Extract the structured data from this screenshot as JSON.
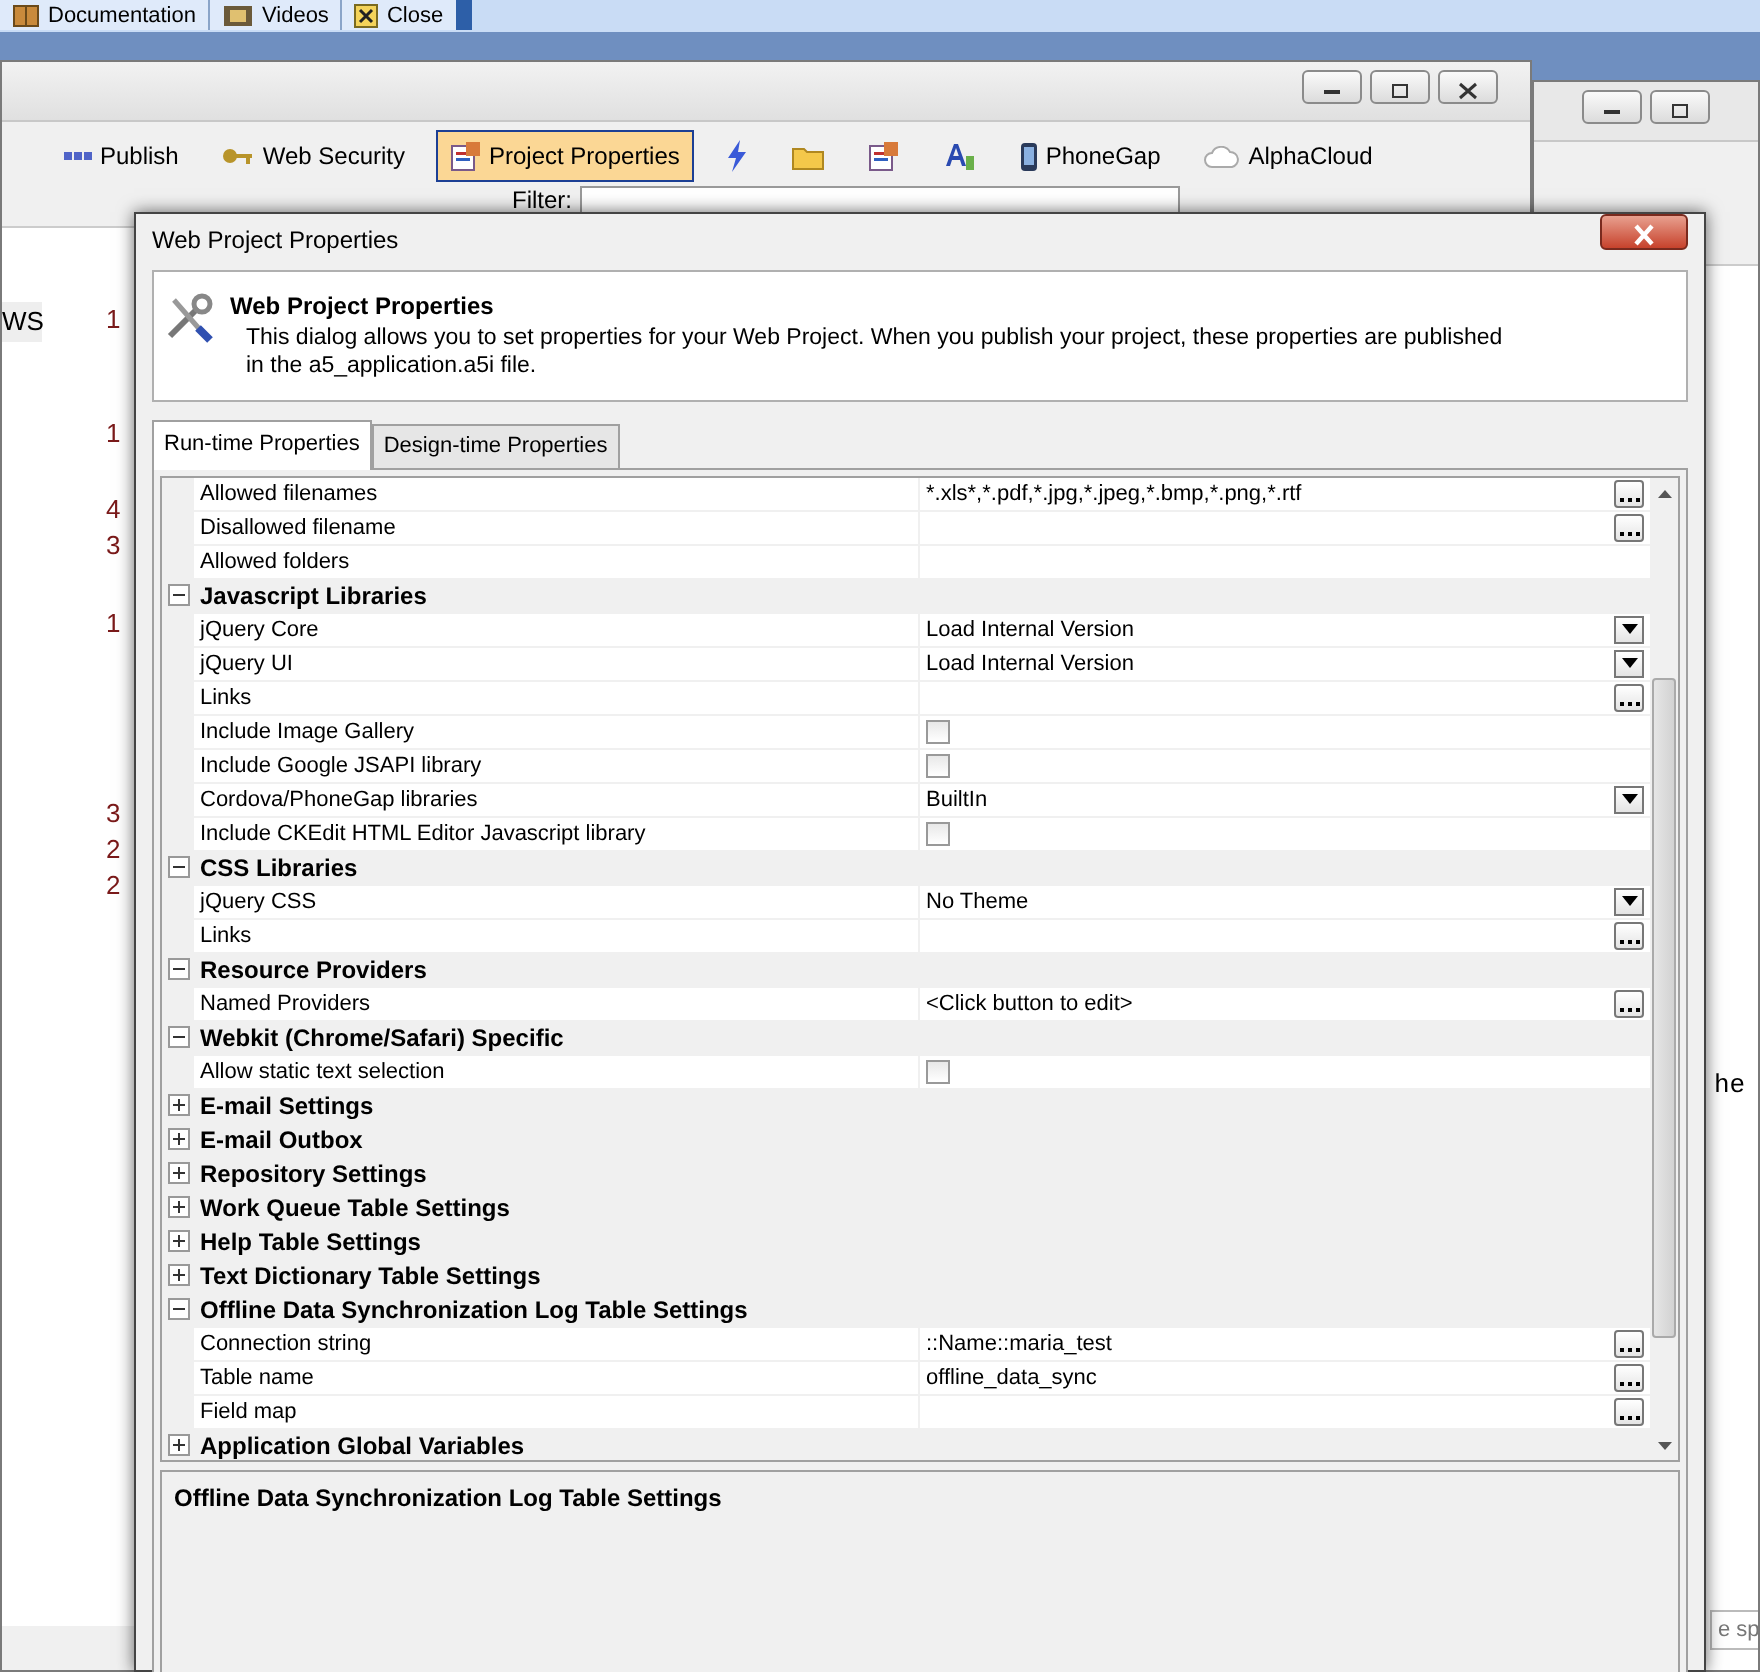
{
  "taskbar": {
    "buttons": [
      {
        "label": "Documentation"
      },
      {
        "label": "Videos"
      },
      {
        "label": "Close"
      }
    ]
  },
  "main_window": {
    "toolbar": [
      {
        "kind": "labeled",
        "label": "Publish",
        "selected": false
      },
      {
        "kind": "labeled",
        "label": "Web Security",
        "selected": false
      },
      {
        "kind": "labeled",
        "label": "Project Properties",
        "selected": true
      },
      {
        "kind": "icon",
        "selected": false
      },
      {
        "kind": "icon",
        "selected": false
      },
      {
        "kind": "icon",
        "selected": false
      },
      {
        "kind": "icon",
        "selected": false
      },
      {
        "kind": "labeled",
        "label": "PhoneGap",
        "selected": false
      },
      {
        "kind": "labeled",
        "label": "AlphaCloud",
        "selected": false
      }
    ],
    "filter_label": "Filter:",
    "list_item": "WS",
    "column_fragments": [
      "1",
      "1",
      "4",
      "3",
      "1",
      "3",
      "2",
      "2"
    ]
  },
  "side_window": {
    "text_fragment": "he",
    "field_fragment": "e sp"
  },
  "dialog": {
    "title": "Web Project Properties",
    "header": {
      "title": "Web Project Properties",
      "description": "This dialog allows you to set properties for your Web Project. When you publish your project, these properties are published in the a5_application.a5i file."
    },
    "tabs": [
      {
        "label": "Run-time Properties",
        "selected": true
      },
      {
        "label": "Design-time Properties",
        "selected": false
      }
    ],
    "rows": [
      {
        "kind": "ellipsis",
        "name": "Allowed filenames",
        "value": "*.xls*,*.pdf,*.jpg,*.jpeg,*.bmp,*.png,*.rtf"
      },
      {
        "kind": "ellipsis",
        "name": "Disallowed filename"
      },
      {
        "kind": "plain",
        "name": "Allowed folders"
      },
      {
        "kind": "category",
        "name": "Javascript Libraries",
        "expanded": true
      },
      {
        "kind": "dropdown",
        "name": "jQuery Core",
        "value": "Load Internal Version"
      },
      {
        "kind": "dropdown",
        "name": "jQuery UI",
        "value": "Load Internal Version"
      },
      {
        "kind": "ellipsis",
        "name": "Links"
      },
      {
        "kind": "checkbox",
        "name": "Include Image Gallery",
        "checked": false
      },
      {
        "kind": "checkbox",
        "name": "Include Google JSAPI library",
        "checked": false
      },
      {
        "kind": "dropdown",
        "name": "Cordova/PhoneGap libraries",
        "value": "BuiltIn"
      },
      {
        "kind": "checkbox",
        "name": "Include CKEdit HTML Editor Javascript library",
        "checked": false
      },
      {
        "kind": "category",
        "name": "CSS Libraries",
        "expanded": true
      },
      {
        "kind": "dropdown",
        "name": "jQuery CSS",
        "value": "No Theme"
      },
      {
        "kind": "ellipsis",
        "name": "Links"
      },
      {
        "kind": "category",
        "name": "Resource Providers",
        "expanded": true
      },
      {
        "kind": "ellipsis",
        "name": "Named Providers",
        "value": "<Click button to edit>"
      },
      {
        "kind": "category",
        "name": "Webkit (Chrome/Safari) Specific",
        "expanded": true
      },
      {
        "kind": "checkbox",
        "name": "Allow static text selection",
        "checked": false
      },
      {
        "kind": "category",
        "name": "E-mail Settings",
        "expanded": false
      },
      {
        "kind": "category",
        "name": "E-mail Outbox",
        "expanded": false
      },
      {
        "kind": "category",
        "name": "Repository Settings",
        "expanded": false
      },
      {
        "kind": "category",
        "name": "Work Queue Table Settings",
        "expanded": false
      },
      {
        "kind": "category",
        "name": "Help Table Settings",
        "expanded": false
      },
      {
        "kind": "category",
        "name": "Text Dictionary Table Settings",
        "expanded": false
      },
      {
        "kind": "category",
        "name": "Offline Data Synchronization Log Table Settings",
        "expanded": true
      },
      {
        "kind": "ellipsis",
        "name": "Connection string",
        "value": "::Name::maria_test"
      },
      {
        "kind": "ellipsis",
        "name": "Table name",
        "value": "offline_data_sync"
      },
      {
        "kind": "ellipsis",
        "name": "Field map"
      },
      {
        "kind": "category",
        "name": "Application Global Variables",
        "expanded": false
      }
    ],
    "description_title": "Offline Data Synchronization Log Table Settings"
  }
}
